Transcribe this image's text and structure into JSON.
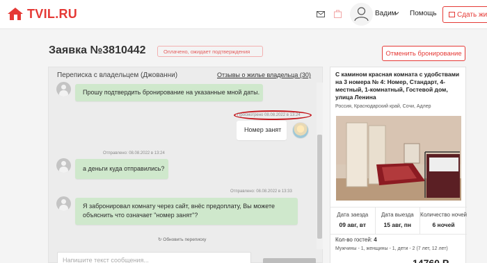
{
  "header": {
    "brand": "TVIL.RU",
    "user_name": "Вадим",
    "help_label": "Помощь",
    "rent_button": "Сдать жилье"
  },
  "request": {
    "title": "Заявка №3810442",
    "status": "Оплачено, ожидает подтверждения",
    "cancel_button": "Отменить бронирование"
  },
  "chat": {
    "title": "Переписка с владельцем (Джованни)",
    "reviews_link": "Отзывы о жилье владельца (30)",
    "messages": [
      {
        "text": "Прошу подтвердить бронирование на указанные мной даты."
      },
      {
        "meta": "Просмотрено 08.08.2022 в 13:24",
        "text": "Номер занят"
      },
      {
        "meta": "Отправлено: 08.08.2022 в 13:24",
        "text": "а деньги куда отправились?"
      },
      {
        "meta": "Отправлено: 08.08.2022 в 13:33",
        "text": "Я забронировал комнату через сайт, внёс предоплату, Вы можете объяснить что означает \"номер занят\"?"
      }
    ],
    "refresh_label": "Обновить переписку",
    "input_placeholder": "Напишите текст сообщения..."
  },
  "listing": {
    "title": "С камином красная комната с удобствами на 3 номера № 4: Номер, Стандарт, 4-местный, 1-комнатный, Гостевой дом, улица Ленина",
    "address": "Россия, Краснодарский край, Сочи, Адлер",
    "checkin_label": "Дата заезда",
    "checkin_value": "09 авг, вт",
    "checkout_label": "Дата выезда",
    "checkout_value": "15 авг, пн",
    "nights_label": "Количество ночей",
    "nights_value": "6 ночей",
    "guests_label": "Кол-во гостей:",
    "guests_value": "4",
    "guests_detail": "Мужчины - 1, женщины - 1, дети - 2 (7 лет, 12 лет)",
    "price": "14760 Р"
  },
  "colors": {
    "brand_red": "#e53935",
    "bubble_green": "#cfe8cc",
    "highlight_oval": "#c4161c"
  }
}
